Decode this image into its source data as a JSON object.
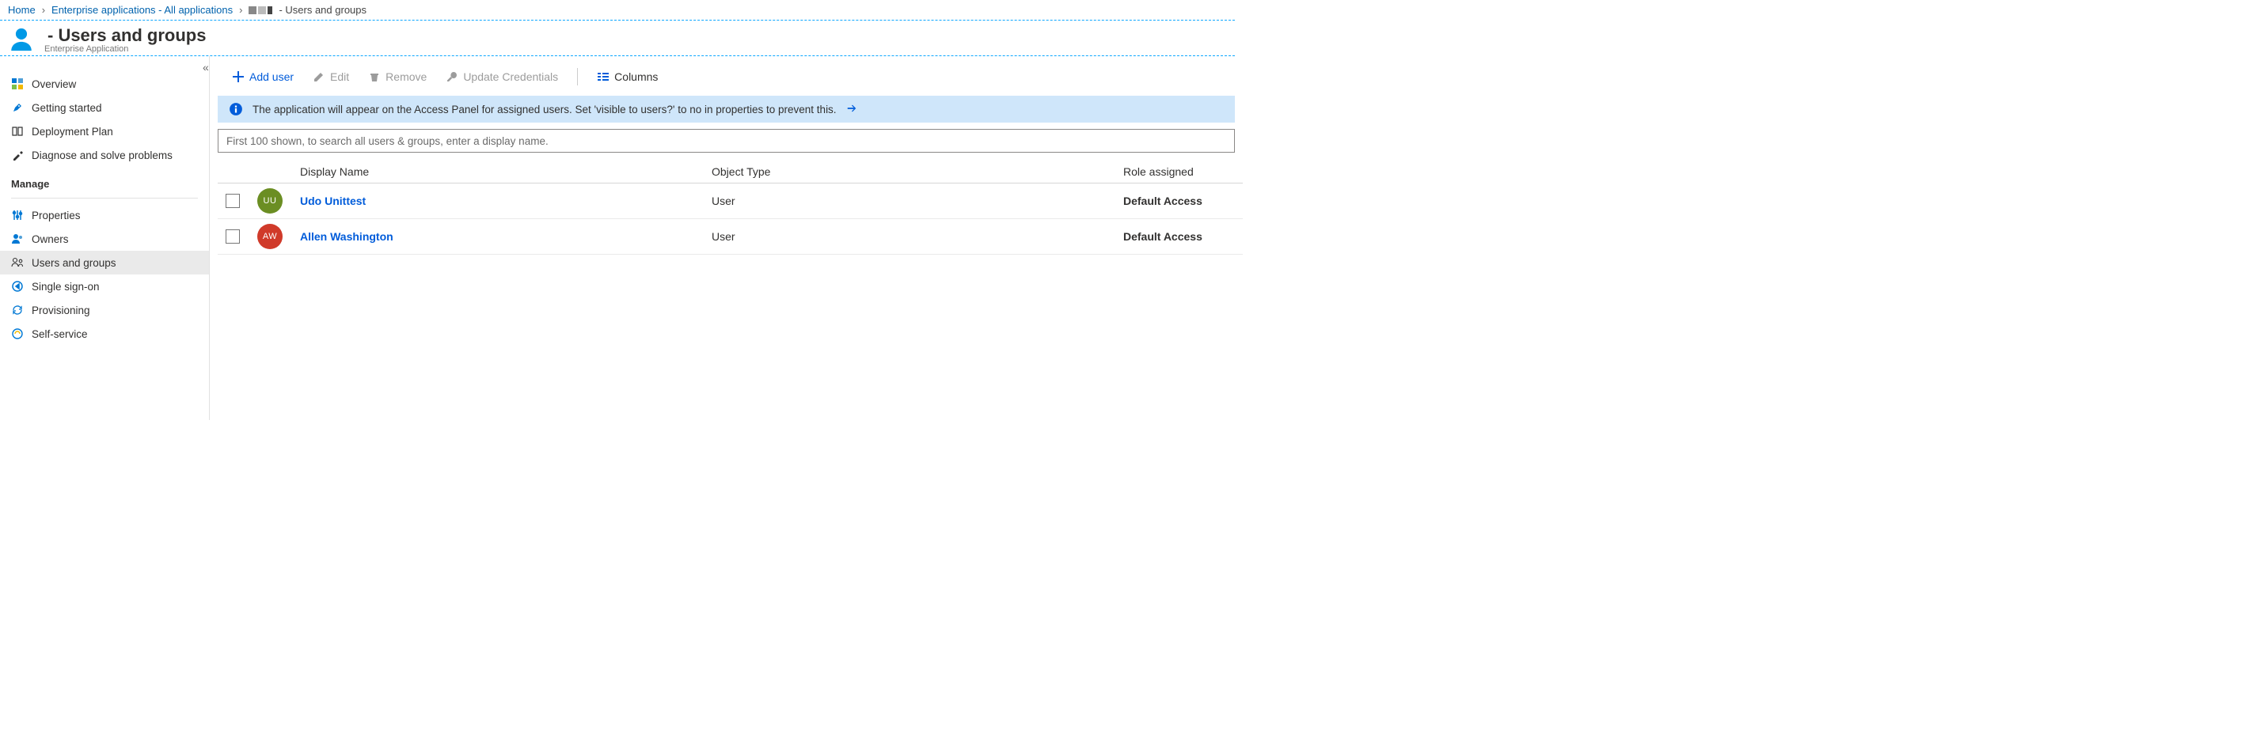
{
  "breadcrumb": {
    "home": "Home",
    "ent_apps": "Enterprise applications - All applications",
    "current": "- Users and groups"
  },
  "header": {
    "title_suffix": "- Users and groups",
    "subtitle": "Enterprise Application"
  },
  "sidebar": {
    "overview": "Overview",
    "getting_started": "Getting started",
    "deployment_plan": "Deployment Plan",
    "diagnose": "Diagnose and solve problems",
    "manage_label": "Manage",
    "properties": "Properties",
    "owners": "Owners",
    "users_groups": "Users and groups",
    "sso": "Single sign-on",
    "provisioning": "Provisioning",
    "self_service": "Self-service"
  },
  "toolbar": {
    "add_user": "Add user",
    "edit": "Edit",
    "remove": "Remove",
    "update_credentials": "Update Credentials",
    "columns": "Columns"
  },
  "info": {
    "text": "The application will appear on the Access Panel for assigned users. Set 'visible to users?' to no in properties to prevent this."
  },
  "search": {
    "placeholder": "First 100 shown, to search all users & groups, enter a display name."
  },
  "table": {
    "columns": {
      "display_name": "Display Name",
      "object_type": "Object Type",
      "role_assigned": "Role assigned"
    },
    "rows": [
      {
        "initials": "UU",
        "color": "#6b8e23",
        "name": "Udo Unittest",
        "type": "User",
        "role": "Default Access"
      },
      {
        "initials": "AW",
        "color": "#d03a2a",
        "name": "Allen Washington",
        "type": "User",
        "role": "Default Access"
      }
    ]
  }
}
